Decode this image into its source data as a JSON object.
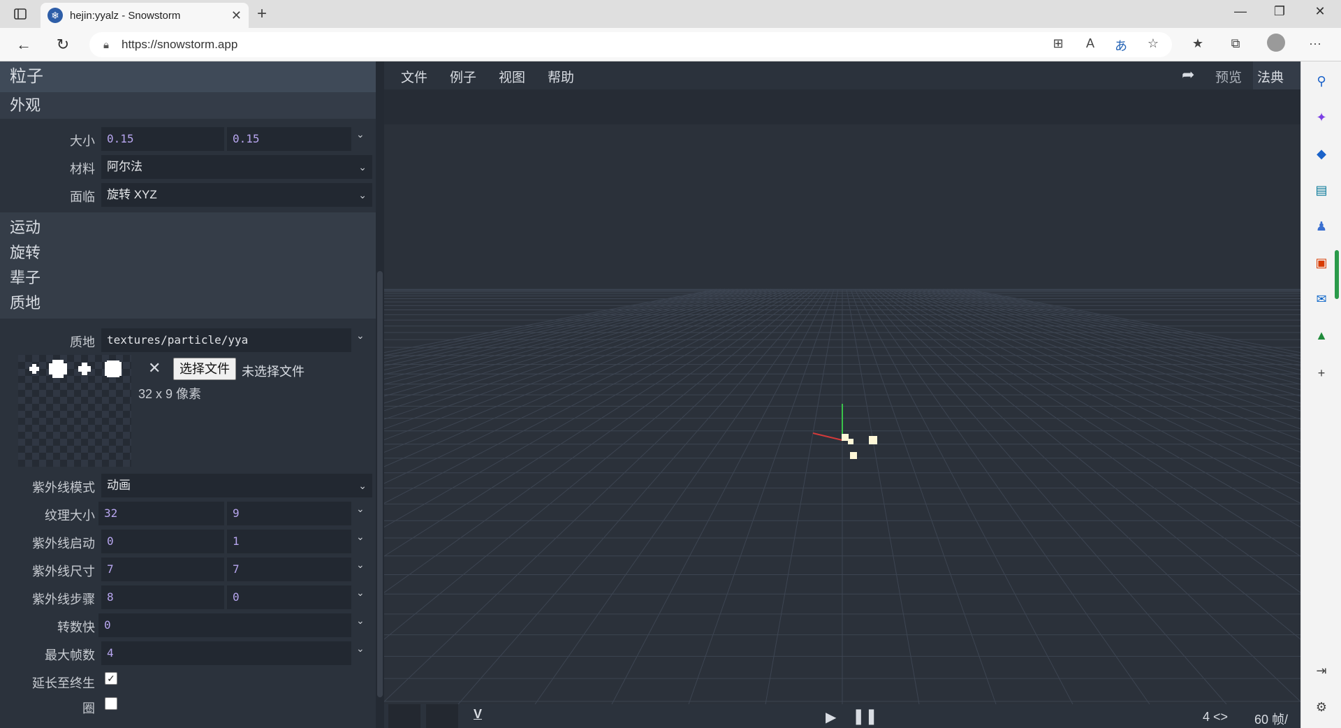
{
  "browser": {
    "tab_title": "hejin:yyalz - Snowstorm",
    "url": "https://snowstorm.app"
  },
  "menu": {
    "items": [
      "文件",
      "例子",
      "视图",
      "帮助"
    ],
    "preview": "预览",
    "codex": "法典"
  },
  "panel": {
    "particle": "粒子",
    "appearance": "外观",
    "size_label": "大小",
    "size_x": "0.15",
    "size_y": "0.15",
    "material_label": "材料",
    "material_value": "阿尔法",
    "facing_label": "面临",
    "facing_value": "旋转 XYZ",
    "motion": "运动",
    "rotation": "旋转",
    "lifetime": "辈子",
    "texture_section": "质地",
    "texture_label": "质地",
    "texture_path": "textures/particle/yya",
    "choose_file": "选择文件",
    "no_file": "未选择文件",
    "dimensions": "32 x 9 像素",
    "uv_mode_label": "紫外线模式",
    "uv_mode_value": "动画",
    "tex_size_label": "纹理大小",
    "tex_size_w": "32",
    "tex_size_h": "9",
    "uv_start_label": "紫外线启动",
    "uv_start_x": "0",
    "uv_start_y": "1",
    "uv_size_label": "紫外线尺寸",
    "uv_size_x": "7",
    "uv_size_y": "7",
    "uv_step_label": "紫外线步骤",
    "uv_step_x": "8",
    "uv_step_y": "0",
    "fps_label": "转数快",
    "fps_value": "0",
    "max_frame_label": "最大帧数",
    "max_frame_value": "4",
    "stretch_label": "延长至终生",
    "stretch_checked": true,
    "loop_label": "圈",
    "loop_checked": false
  },
  "bottom": {
    "frame": "4 <>",
    "fps": "60 帧/"
  },
  "colors": {
    "accent_value": "#b8a6f0",
    "panel_bg": "#2b323c",
    "viewport_bg": "#2b313a",
    "axis_x": "#d23a3a",
    "axis_y": "#3ac24a"
  }
}
